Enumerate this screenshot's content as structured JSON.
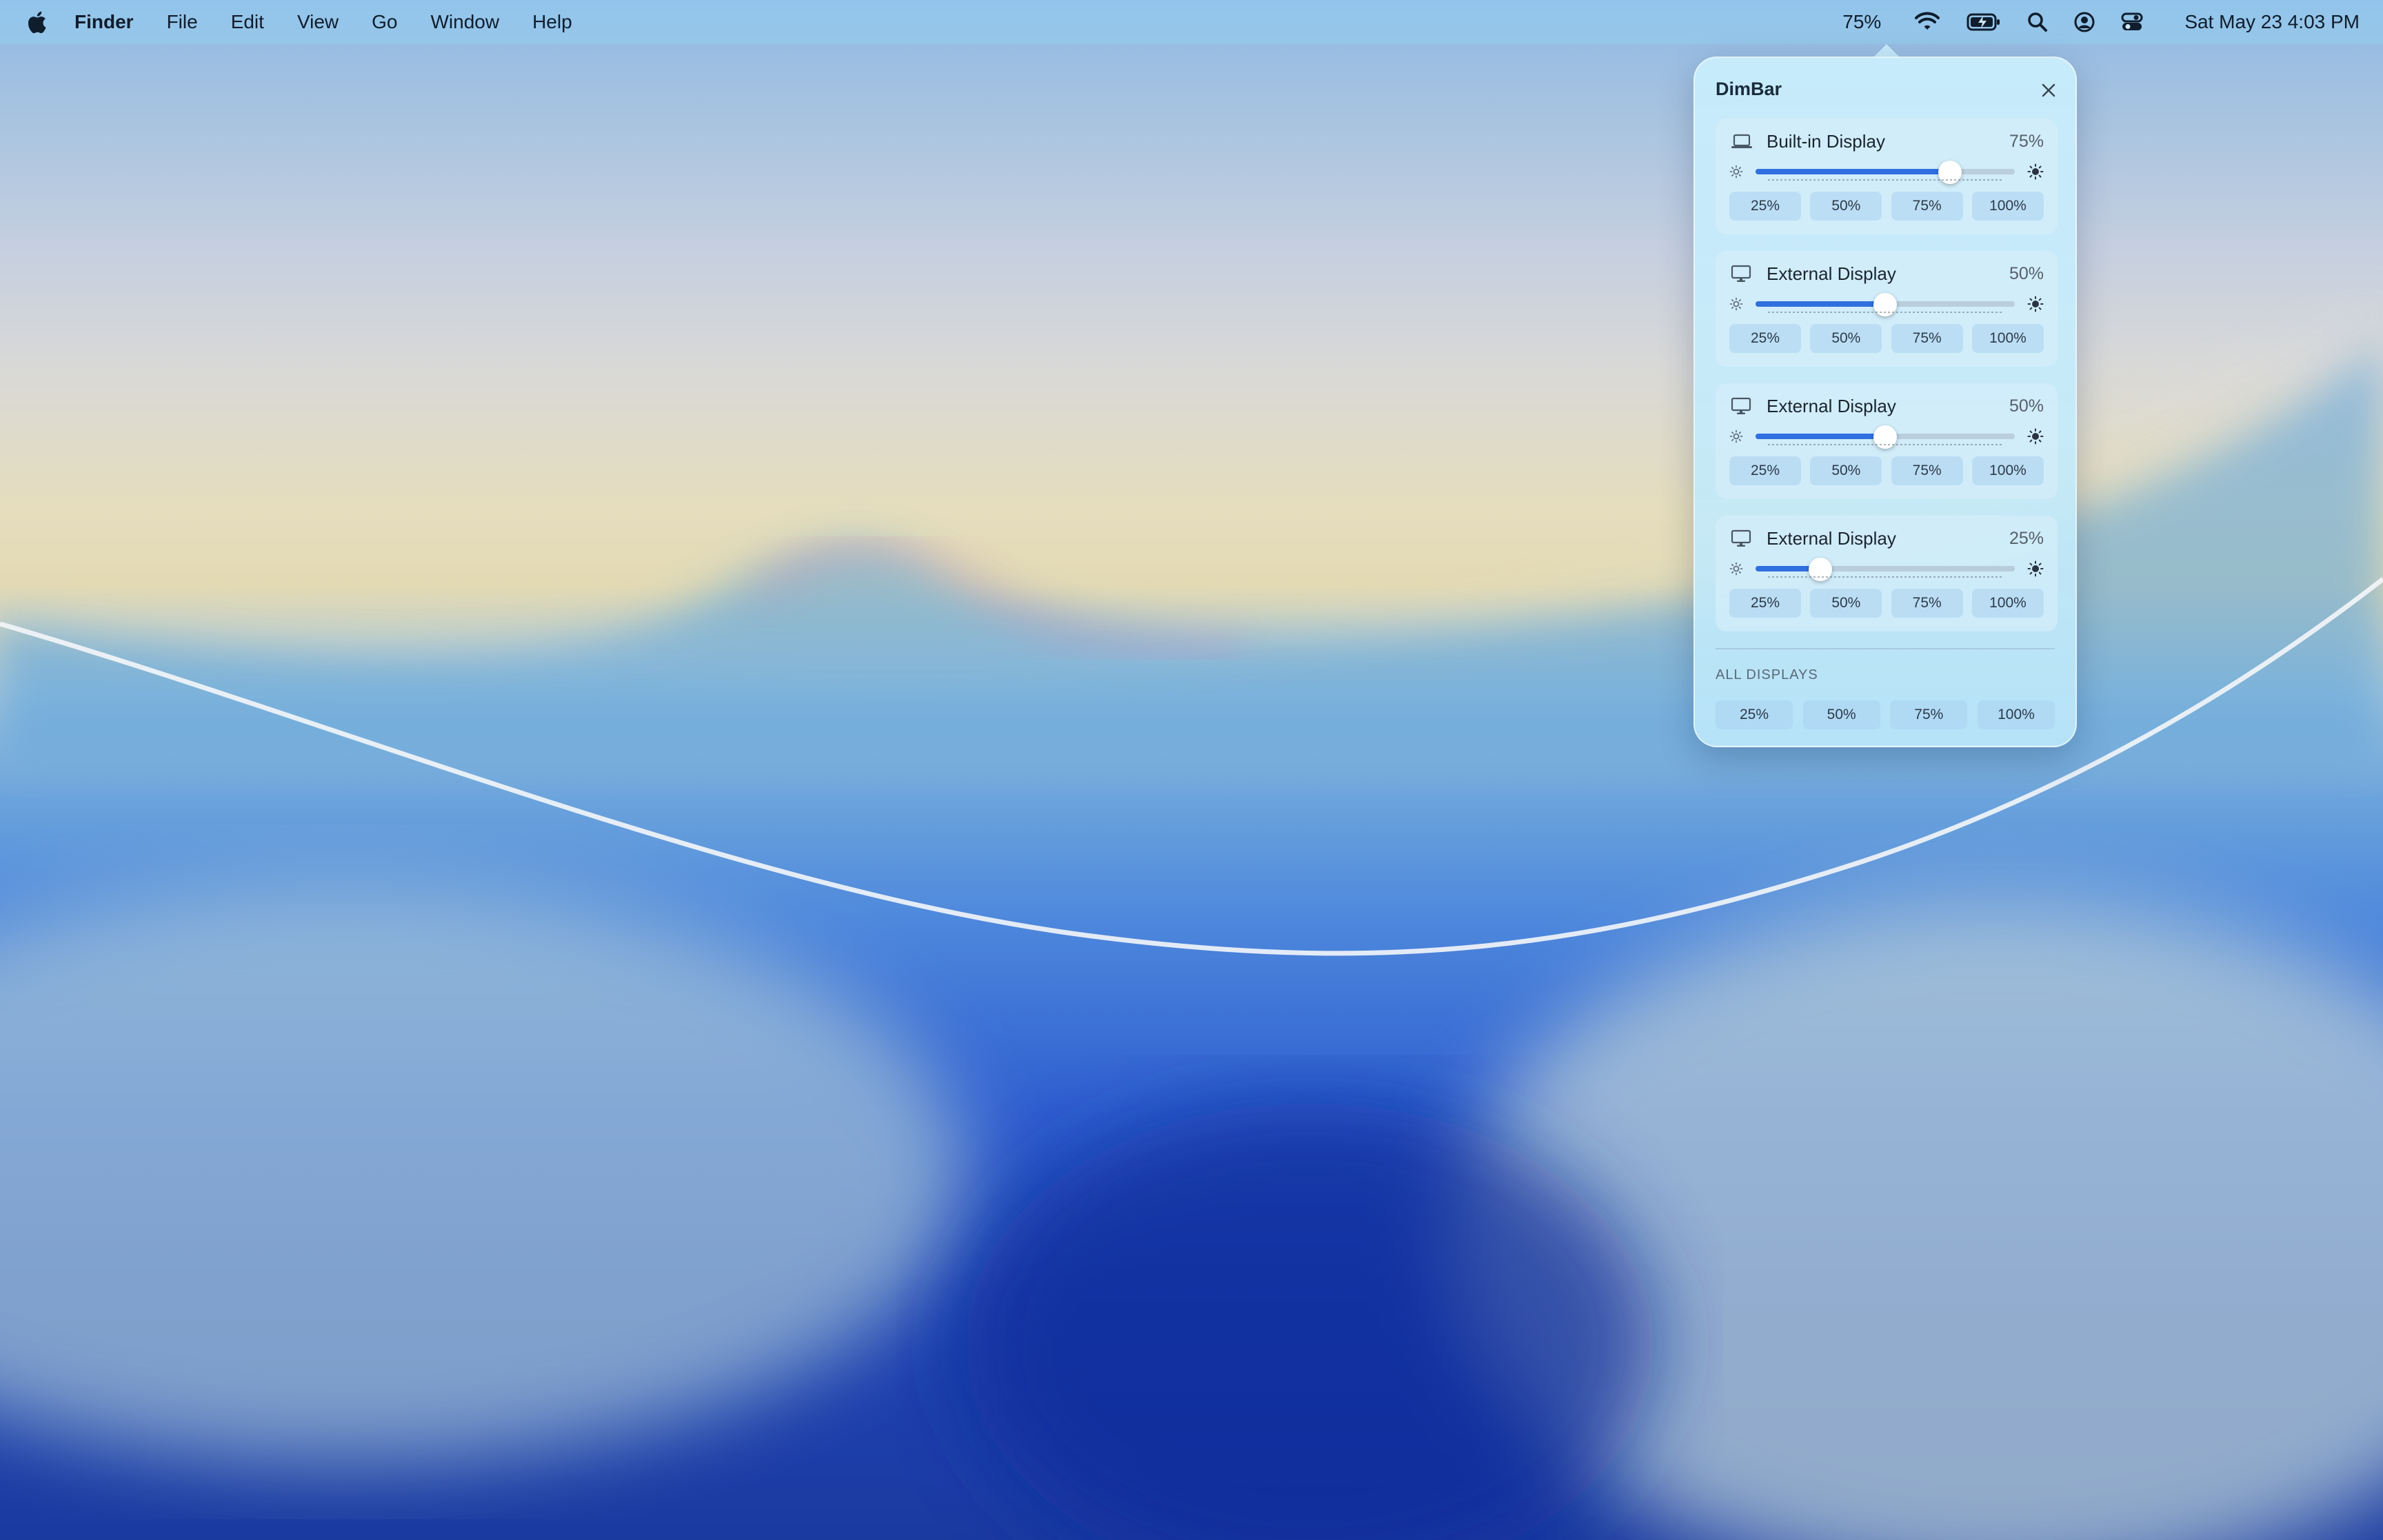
{
  "menubar": {
    "apple_icon": "apple-logo",
    "app_name": "Finder",
    "menus": [
      "File",
      "Edit",
      "View",
      "Go",
      "Window",
      "Help"
    ],
    "status": {
      "dimbar_percent": "75%",
      "icons": [
        "wifi-icon",
        "battery-icon",
        "search-icon",
        "user-icon",
        "control-center-icon"
      ],
      "clock": "Sat May 23  4:03 PM"
    }
  },
  "popover": {
    "title": "DimBar",
    "close_icon": "close-icon",
    "displays": [
      {
        "name": "Built-in Display",
        "percent_label": "75%",
        "brightness": 0.75,
        "icon": "laptop-icon"
      },
      {
        "name": "External Display",
        "percent_label": "50%",
        "brightness": 0.5,
        "icon": "monitor-icon"
      },
      {
        "name": "External Display",
        "percent_label": "50%",
        "brightness": 0.5,
        "icon": "monitor-icon"
      },
      {
        "name": "External Display",
        "percent_label": "25%",
        "brightness": 0.25,
        "icon": "monitor-icon"
      }
    ],
    "presets": [
      "25%",
      "50%",
      "75%",
      "100%"
    ],
    "all_displays": {
      "label": "ALL DISPLAYS",
      "presets": [
        "25%",
        "50%",
        "75%",
        "100%"
      ]
    }
  },
  "colors": {
    "accent": "#2f6fe0",
    "popover_bg": "#caeefc",
    "menubar_text": "#0f1d2c"
  }
}
